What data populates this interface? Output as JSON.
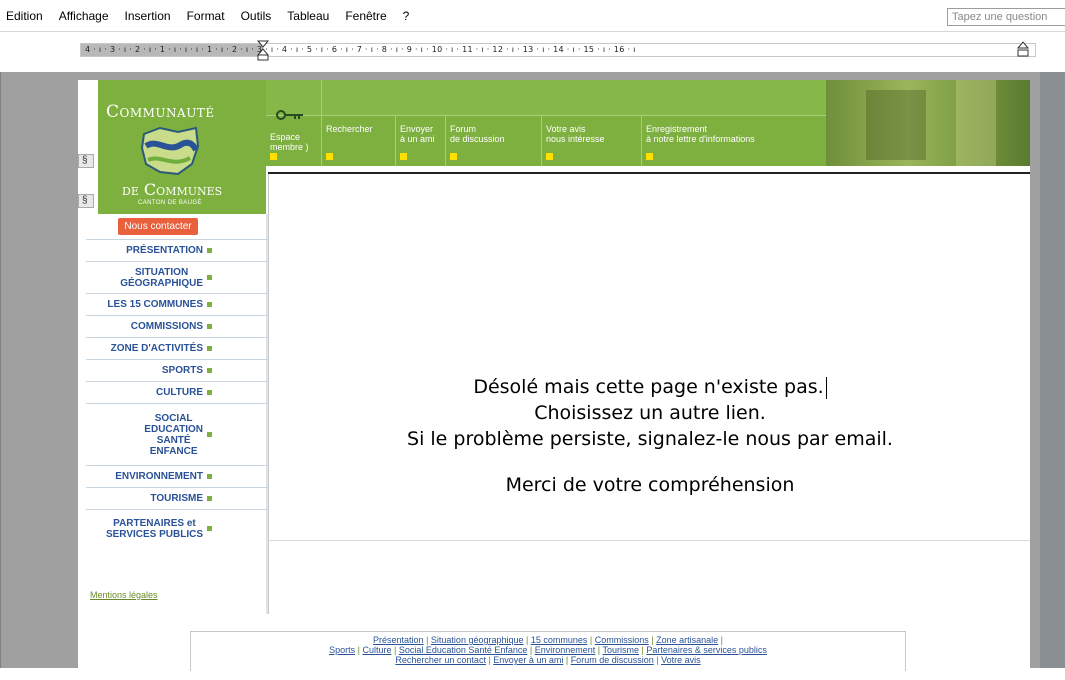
{
  "menubar": {
    "items": [
      "Edition",
      "Affichage",
      "Insertion",
      "Format",
      "Outils",
      "Tableau",
      "Fenêtre",
      "?"
    ],
    "help_placeholder": "Tapez une question"
  },
  "ruler": {
    "text": "4 · ı · 3 · ı · 2 · ı · 1 · ı · ı · ı · 1 · ı · 2 · ı · 3 · ı · 4 · ı · 5 · ı · 6 · ı · 7 · ı · 8 · ı · 9 · ı · 10 · ı · 11 · ı · 12 · ı · 13 · ı · 14 · ı · 15 · ı · 16 · ı"
  },
  "banner": {
    "logo_title": "Communauté",
    "logo_sub": "de Communes",
    "logo_caption": "CANTON DE BAUGÉ",
    "key_label": "Espace\nmembre )",
    "nav_buttons": [
      {
        "label": "Rechercher"
      },
      {
        "label": "Envoyer\nà un ami"
      },
      {
        "label": "Forum\nde discussion"
      },
      {
        "label": "Votre avis\nnous intéresse"
      },
      {
        "label": "Enregistrement\nà notre lettre d'informations"
      }
    ]
  },
  "sidebar": {
    "contact_label": "Nous contacter",
    "items": [
      {
        "label": "PRÉSENTATION"
      },
      {
        "label": "SITUATION\nGÉOGRAPHIQUE"
      },
      {
        "label": "LES 15 COMMUNES"
      },
      {
        "label": "COMMISSIONS"
      },
      {
        "label": "ZONE D'ACTIVITÉS"
      },
      {
        "label": "SPORTS"
      },
      {
        "label": "CULTURE"
      },
      {
        "label": "SOCIAL\nEDUCATION\nSANTÉ\nENFANCE"
      },
      {
        "label": "ENVIRONNEMENT"
      },
      {
        "label": "TOURISME"
      },
      {
        "label": "PARTENAIRES et\nSERVICES PUBLICS"
      }
    ],
    "legal_label": "Mentions légales"
  },
  "content": {
    "line1": "Désolé mais cette page n'existe pas.",
    "line2": "Choisissez un autre lien.",
    "line3": "Si le problème persiste, signalez-le nous par email.",
    "thanks": "Merci de votre compréhension"
  },
  "footer": {
    "row1": [
      "Présentation",
      "Situation géographique",
      "15 communes",
      "Commissions",
      "Zone artisanale"
    ],
    "row2": [
      "Sports",
      "Culture",
      "Social Education Santé Enfance",
      "Environnement",
      "Tourisme",
      "Partenaires & services publics"
    ],
    "row3": [
      "Rechercher un contact",
      "Envoyer à un ami",
      "Forum de discussion",
      "Votre avis"
    ]
  },
  "colors": {
    "brand_green": "#7db03e",
    "nav_link_blue": "#2a5298",
    "contact_orange": "#e8603c",
    "marker_yellow": "#ffe000"
  }
}
